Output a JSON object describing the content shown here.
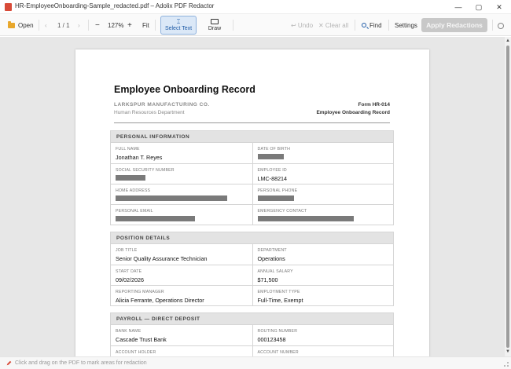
{
  "window": {
    "title": "HR-EmployeeOnboarding-Sample_redacted.pdf – Adolix PDF Redactor",
    "controls": [
      "—",
      "▢",
      "✕"
    ]
  },
  "toolbar": {
    "open_label": "Open",
    "prev_glyph": "‹",
    "page_indicator": "1 / 1",
    "next_glyph": "›",
    "zoom_out_glyph": "−",
    "zoom_level": "127%",
    "zoom_in_glyph": "+",
    "fit_label": "Fit",
    "select_text_label": "Select Text",
    "draw_label": "Draw",
    "undo_label": "↩ Undo",
    "clear_all_label": "✕ Clear all",
    "find_label": "Find",
    "settings_label": "Settings",
    "apply_label": "Apply Redactions"
  },
  "document": {
    "title": "Employee Onboarding Record",
    "company": "LARKSPUR MANUFACTURING CO.",
    "department": "Human Resources Department",
    "form_number": "Form HR-014",
    "form_name": "Employee Onboarding Record",
    "sections": [
      {
        "header": "PERSONAL INFORMATION",
        "rows": [
          [
            {
              "label": "FULL NAME",
              "value": "Jonathan T. Reyes",
              "redacted": false
            },
            {
              "label": "DATE OF BIRTH",
              "value": "",
              "redacted": true
            }
          ],
          [
            {
              "label": "SOCIAL SECURITY NUMBER",
              "value": "",
              "redacted": true
            },
            {
              "label": "EMPLOYEE ID",
              "value": "LMC-88214",
              "redacted": false
            }
          ],
          [
            {
              "label": "HOME ADDRESS",
              "value": "",
              "redacted": true
            },
            {
              "label": "PERSONAL PHONE",
              "value": "",
              "redacted": true
            }
          ],
          [
            {
              "label": "PERSONAL EMAIL",
              "value": "",
              "redacted": true
            },
            {
              "label": "EMERGENCY CONTACT",
              "value": "",
              "redacted": true
            }
          ]
        ]
      },
      {
        "header": "POSITION DETAILS",
        "rows": [
          [
            {
              "label": "JOB TITLE",
              "value": "Senior Quality Assurance Technician",
              "redacted": false
            },
            {
              "label": "DEPARTMENT",
              "value": "Operations",
              "redacted": false
            }
          ],
          [
            {
              "label": "START DATE",
              "value": "09/02/2026",
              "redacted": false
            },
            {
              "label": "ANNUAL SALARY",
              "value": "$71,500",
              "redacted": false
            }
          ],
          [
            {
              "label": "REPORTING MANAGER",
              "value": "Alicia Ferrante, Operations Director",
              "redacted": false
            },
            {
              "label": "EMPLOYMENT TYPE",
              "value": "Full-Time, Exempt",
              "redacted": false
            }
          ]
        ]
      },
      {
        "header": "PAYROLL — DIRECT DEPOSIT",
        "rows": [
          [
            {
              "label": "BANK NAME",
              "value": "Cascade Trust Bank",
              "redacted": false
            },
            {
              "label": "ROUTING NUMBER",
              "value": "000123458",
              "redacted": false
            }
          ],
          [
            {
              "label": "ACCOUNT HOLDER",
              "value": "",
              "redacted": false
            },
            {
              "label": "ACCOUNT NUMBER",
              "value": "",
              "redacted": false
            }
          ]
        ]
      }
    ]
  },
  "status": {
    "hint": "Click and drag on the PDF to mark areas for redaction"
  },
  "colors": {
    "accent": "#1d5aa6",
    "redaction": "#7a7a7a",
    "apply_disabled": "#c8c8c8"
  }
}
